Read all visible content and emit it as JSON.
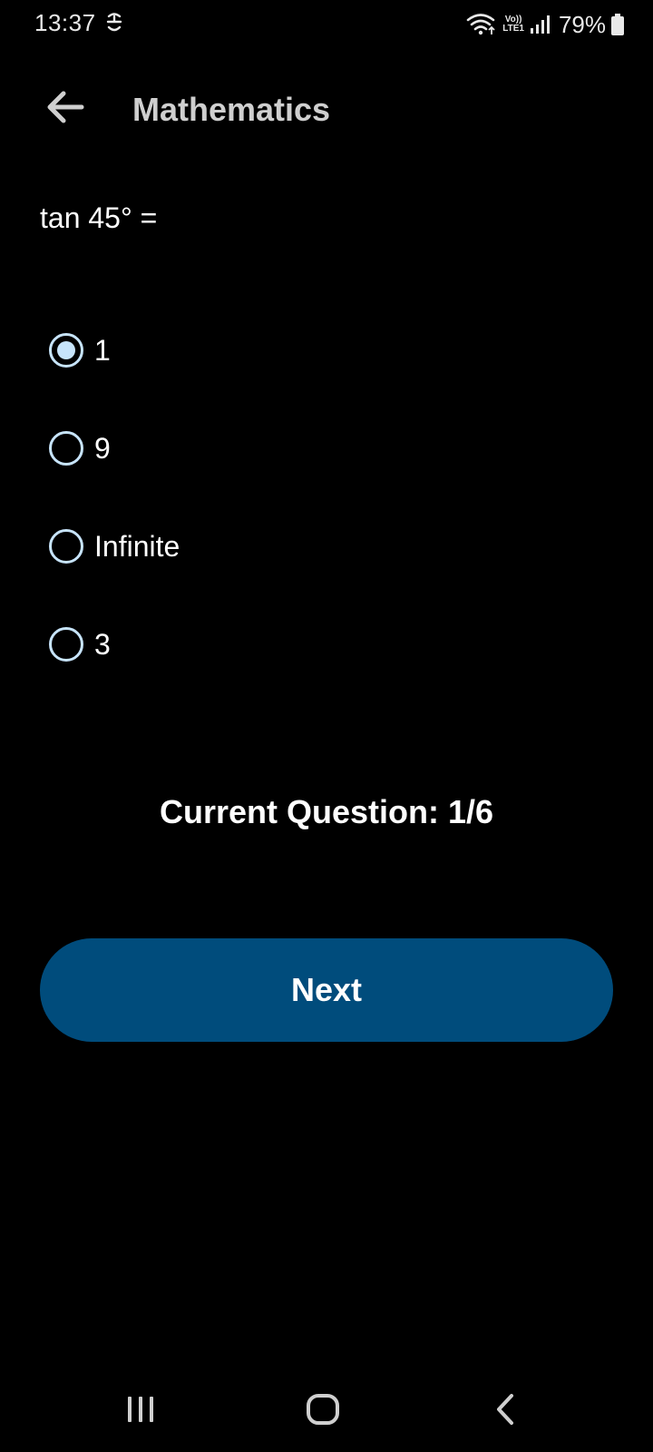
{
  "status_bar": {
    "time": "13:37",
    "battery_percent": "79%",
    "volte_top": "Vo))",
    "volte_bottom": "LTE1",
    "icons": [
      "notification-icon",
      "wifi-icon",
      "volte-icon",
      "signal-icon",
      "battery-icon"
    ]
  },
  "app_bar": {
    "title": "Mathematics",
    "back_icon": "arrow-left-icon"
  },
  "question": {
    "text": "tan 45° =",
    "options": [
      {
        "label": "1",
        "selected": true
      },
      {
        "label": "9",
        "selected": false
      },
      {
        "label": "Infinite",
        "selected": false
      },
      {
        "label": "3",
        "selected": false
      }
    ]
  },
  "progress": {
    "text": "Current Question: 1/6",
    "current": 1,
    "total": 6
  },
  "actions": {
    "next_label": "Next"
  },
  "nav_bar": {
    "icons": [
      "recents-icon",
      "home-icon",
      "back-icon"
    ]
  },
  "colors": {
    "background": "#000000",
    "accent": "#004c7c",
    "radio": "#c7e4fb",
    "title": "#cfcfcf"
  }
}
